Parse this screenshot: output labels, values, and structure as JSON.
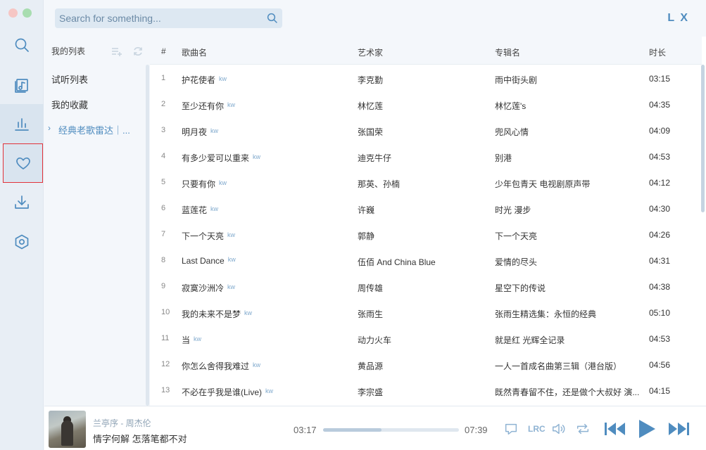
{
  "app": {
    "logo": "L X",
    "search_placeholder": "Search for something..."
  },
  "lists_panel": {
    "heading": "我的列表",
    "items": [
      {
        "label": "试听列表"
      },
      {
        "label": "我的收藏"
      },
      {
        "label": "经典老歌雷达｜..."
      }
    ]
  },
  "table": {
    "headers": {
      "index": "#",
      "title": "歌曲名",
      "artist": "艺术家",
      "album": "专辑名",
      "duration": "时长"
    },
    "source_tag": "kw",
    "rows": [
      {
        "n": "1",
        "title": "护花使者",
        "artist": "李克勤",
        "album": "雨中街头剧",
        "duration": "03:15"
      },
      {
        "n": "2",
        "title": "至少还有你",
        "artist": "林忆莲",
        "album": "林忆莲's",
        "duration": "04:35"
      },
      {
        "n": "3",
        "title": "明月夜",
        "artist": "张国荣",
        "album": "兜风心情",
        "duration": "04:09"
      },
      {
        "n": "4",
        "title": "有多少爱可以重来",
        "artist": "迪克牛仔",
        "album": "别港",
        "duration": "04:53"
      },
      {
        "n": "5",
        "title": "只要有你",
        "artist": "那英、孙楠",
        "album": "少年包青天 电视剧原声带",
        "duration": "04:12"
      },
      {
        "n": "6",
        "title": "蓝莲花",
        "artist": "许巍",
        "album": "时光 漫步",
        "duration": "04:30"
      },
      {
        "n": "7",
        "title": "下一个天亮",
        "artist": "郭静",
        "album": "下一个天亮",
        "duration": "04:26"
      },
      {
        "n": "8",
        "title": "Last Dance",
        "artist": "伍佰 And China Blue",
        "album": "爱情的尽头",
        "duration": "04:31"
      },
      {
        "n": "9",
        "title": "寂寞沙洲冷",
        "artist": "周传雄",
        "album": "星空下的传说",
        "duration": "04:38"
      },
      {
        "n": "10",
        "title": "我的未来不是梦",
        "artist": "张雨生",
        "album": "张雨生精选集：永恒的经典",
        "duration": "05:10"
      },
      {
        "n": "11",
        "title": "当",
        "artist": "动力火车",
        "album": "就是红 光辉全记录",
        "duration": "04:53"
      },
      {
        "n": "12",
        "title": "你怎么舍得我难过",
        "artist": "黄品源",
        "album": "一人一首成名曲第三辑（港台版）",
        "duration": "04:56"
      },
      {
        "n": "13",
        "title": "不必在乎我是谁(Live)",
        "artist": "李宗盛",
        "album": "既然青春留不住，还是做个大叔好 演...",
        "duration": "04:15"
      }
    ]
  },
  "player": {
    "track": "兰亭序 - 周杰伦",
    "lyric": "情字何解 怎落笔都不对",
    "current_time": "03:17",
    "total_time": "07:39",
    "progress_fraction": 0.43,
    "lrc_label": "LRC"
  },
  "colors": {
    "accent": "#4f8cbf",
    "rail_bg": "#e8eef5",
    "highlight_border": "#e2323a"
  }
}
